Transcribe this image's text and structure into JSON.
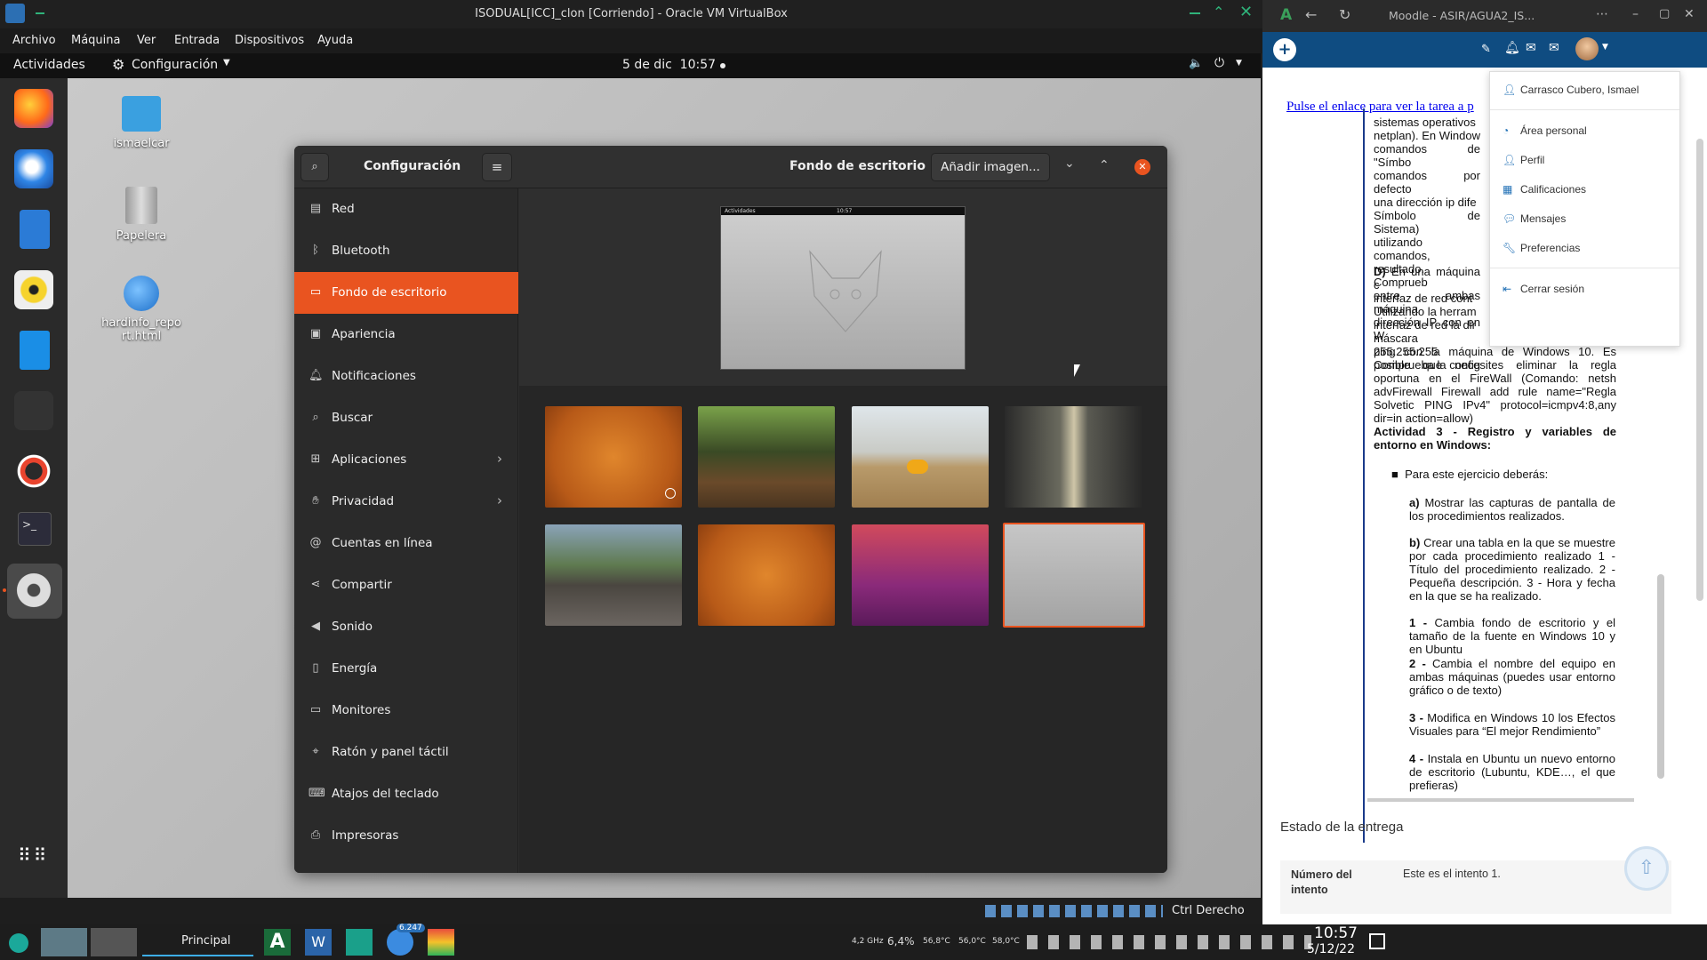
{
  "vbox": {
    "title": "ISODUAL[ICC]_clon [Corriendo] - Oracle VM VirtualBox",
    "menu": [
      "Archivo",
      "Máquina",
      "Ver",
      "Entrada",
      "Dispositivos",
      "Ayuda"
    ],
    "host_key": "Ctrl Derecho"
  },
  "gnome": {
    "activities": "Actividades",
    "app_menu": "Configuración",
    "clock": "5 de dic  10:57"
  },
  "desktop_icons": [
    {
      "label": "ismaelcar"
    },
    {
      "label": "Papelera"
    },
    {
      "label": "hardinfo_report.html"
    }
  ],
  "settings": {
    "title": "Configuración",
    "page_title": "Fondo de escritorio",
    "add_image": "Añadir imagen...",
    "sidebar": [
      {
        "label": "Red",
        "icon": "network-icon"
      },
      {
        "label": "Bluetooth",
        "icon": "bluetooth-icon"
      },
      {
        "label": "Fondo de escritorio",
        "icon": "background-icon",
        "active": true
      },
      {
        "label": "Apariencia",
        "icon": "appearance-icon"
      },
      {
        "label": "Notificaciones",
        "icon": "bell-icon"
      },
      {
        "label": "Buscar",
        "icon": "search-icon"
      },
      {
        "label": "Aplicaciones",
        "icon": "apps-grid-icon",
        "chevron": true
      },
      {
        "label": "Privacidad",
        "icon": "hand-icon",
        "chevron": true
      },
      {
        "label": "Cuentas en línea",
        "icon": "at-icon"
      },
      {
        "label": "Compartir",
        "icon": "share-icon"
      },
      {
        "label": "Sonido",
        "icon": "speaker-icon"
      },
      {
        "label": "Energía",
        "icon": "battery-icon"
      },
      {
        "label": "Monitores",
        "icon": "monitor-icon"
      },
      {
        "label": "Ratón y panel táctil",
        "icon": "mouse-icon"
      },
      {
        "label": "Atajos del teclado",
        "icon": "keyboard-icon"
      },
      {
        "label": "Impresoras",
        "icon": "printer-icon"
      }
    ],
    "preview_topbar": {
      "left": "Actividades",
      "center": "10:57"
    }
  },
  "browser": {
    "tab_title": "Moodle - ASIR/AGUA2_IS...",
    "user_menu": {
      "user": "Carrasco Cubero, Ismael",
      "items": [
        "Área personal",
        "Perfil",
        "Calificaciones",
        "Mensajes",
        "Preferencias"
      ],
      "logout": "Cerrar sesión"
    },
    "link_text": "Pulse el enlace para ver la tarea a p",
    "para1_lines": [
      "sistemas operativos",
      "netplan). En Window",
      "comandos de \"Símbo",
      "comandos por defecto",
      "una dirección ip dife",
      "Símbolo de Sistema)",
      "utilizando comandos,",
      "resultado. Comprueb",
      "entre ambas máquina",
      "dirección IP con en W"
    ],
    "para2_bold": "D)",
    "para2_lines": [
      "En una máquina c",
      "interfaz de red cont",
      "Utilizando la herram",
      "interfaz de red la dir",
      "máscara 255.255.255",
      "Comprueba la config"
    ],
    "para2_rest": "ping con la máquina de Windows 10. Es posible que necesites eliminar la regla oportuna en el FireWall (Comando: netsh advFirewall Firewall add rule name=\"Regla Solvetic PING IPv4\" protocol=icmpv4:8,any dir=in action=allow)",
    "activity_title": "Actividad 3 - Registro y variables de entorno en Windows:",
    "bullet": "Para este ejercicio deberás:",
    "a_bold": "a)",
    "a_text": "Mostrar las capturas de pantalla de los procedimientos realizados.",
    "b_bold": "b)",
    "b_text": "Crear una tabla en la que se muestre por cada procedimiento realizado 1 - Título del procedimiento realizado. 2 - Pequeña descripción. 3 - Hora y fecha en la que se ha realizado.",
    "items": [
      {
        "n": "1 -",
        "t": "Cambia fondo de escritorio y el tamaño de la fuente en Windows 10 y en Ubuntu"
      },
      {
        "n": "2 -",
        "t": "Cambia el nombre del equipo en ambas máquinas (puedes usar entorno gráfico o de texto)"
      },
      {
        "n": "3 -",
        "t": "Modifica en Windows 10 los Efectos Visuales para “El mejor Rendimiento”"
      },
      {
        "n": "4 -",
        "t": "Instala en Ubuntu un nuevo entorno de escritorio (Lubuntu, KDE…, el que prefieras)"
      }
    ],
    "status_heading": "Estado de la entrega",
    "attempt_label_1": "Número del",
    "attempt_label_2": "intento",
    "attempt_value": "Este es el intento 1."
  },
  "taskbar": {
    "window_label": "Principal",
    "badge": "6.247",
    "cpu_freq": "4,2 GHz",
    "cpu_load": "6,4%",
    "temps": [
      "56,8°C",
      "56,0°C",
      "58,0°C"
    ],
    "time": "10:57",
    "date": "5/12/22"
  },
  "colors": {
    "ubuntu_orange": "#e95420",
    "moodle_blue": "#0f4c81"
  }
}
